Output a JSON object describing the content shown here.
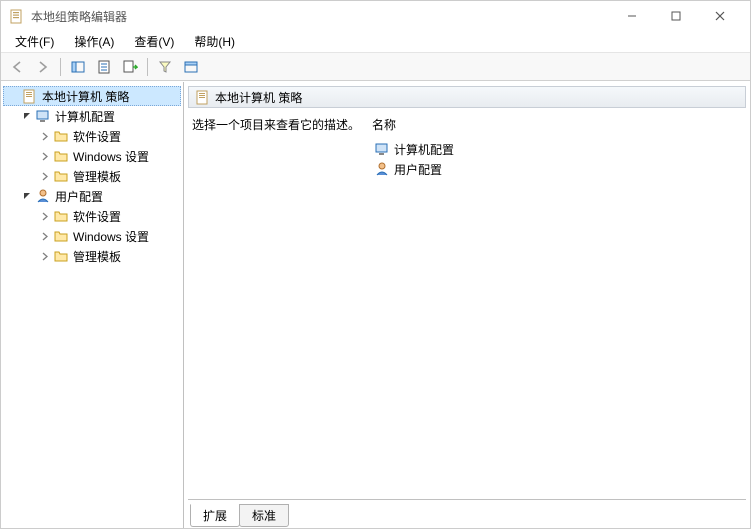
{
  "window": {
    "title": "本地组策略编辑器"
  },
  "menu": {
    "file": "文件(F)",
    "action": "操作(A)",
    "view": "查看(V)",
    "help": "帮助(H)"
  },
  "tree": {
    "root": "本地计算机 策略",
    "comp": "计算机配置",
    "comp_software": "软件设置",
    "comp_windows": "Windows 设置",
    "comp_admin": "管理模板",
    "user": "用户配置",
    "user_software": "软件设置",
    "user_windows": "Windows 设置",
    "user_admin": "管理模板"
  },
  "content": {
    "header_title": "本地计算机 策略",
    "desc_prompt": "选择一个项目来查看它的描述。",
    "name_header": "名称",
    "item_comp": "计算机配置",
    "item_user": "用户配置"
  },
  "tabs": {
    "extended": "扩展",
    "standard": "标准"
  }
}
